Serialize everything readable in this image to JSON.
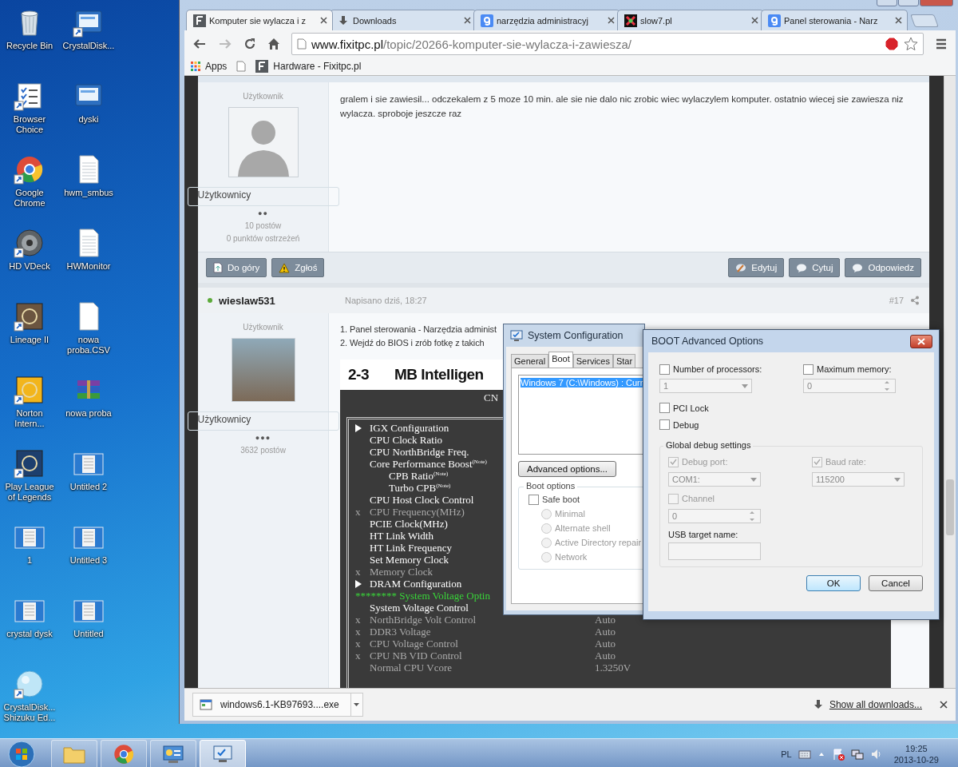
{
  "desktop": {
    "icons": [
      {
        "label": "Recycle Bin",
        "kind": "bin",
        "shortcut": false
      },
      {
        "label": "CrystalDisk...",
        "kind": "monitor",
        "shortcut": true
      },
      {
        "label": "Browser Choice",
        "kind": "checklist",
        "shortcut": true
      },
      {
        "label": "dyski",
        "kind": "monitor",
        "shortcut": false
      },
      {
        "label": "Google Chrome",
        "kind": "chrome",
        "shortcut": true
      },
      {
        "label": "hwm_smbus",
        "kind": "document",
        "shortcut": false
      },
      {
        "label": "HD VDeck",
        "kind": "disc",
        "shortcut": true
      },
      {
        "label": "HWMonitor",
        "kind": "document",
        "shortcut": false
      },
      {
        "label": "Lineage II",
        "kind": "tile",
        "color": "#6b5540",
        "shortcut": true
      },
      {
        "label": "nowa proba.CSV",
        "kind": "blank",
        "shortcut": false
      },
      {
        "label": "Norton Intern...",
        "kind": "tile",
        "color": "#f2b51c",
        "shortcut": true
      },
      {
        "label": "nowa proba",
        "kind": "archive",
        "shortcut": false
      },
      {
        "label": "Play League of Legends",
        "kind": "tile",
        "color": "#1d3f6e",
        "shortcut": true
      },
      {
        "label": "Untitled 2",
        "kind": "thumbnail",
        "shortcut": false
      },
      {
        "label": "1",
        "kind": "thumbnail",
        "shortcut": false
      },
      {
        "label": "Untitled 3",
        "kind": "thumbnail",
        "shortcut": false
      },
      {
        "label": "crystal dysk",
        "kind": "thumbnail",
        "shortcut": false
      },
      {
        "label": "Untitled",
        "kind": "thumbnail",
        "shortcut": false
      },
      {
        "label": "CrystalDisk... Shizuku Ed...",
        "kind": "sphere",
        "shortcut": true
      }
    ]
  },
  "browser": {
    "tabs": [
      {
        "title": "Komputer sie wylacza i z",
        "kind": "site",
        "selected": true
      },
      {
        "title": "Downloads",
        "kind": "download",
        "selected": false
      },
      {
        "title": "narzędzia administracyj",
        "kind": "search",
        "selected": false
      },
      {
        "title": "slow7.pl",
        "kind": "mosaic",
        "selected": false
      },
      {
        "title": "Panel sterowania - Narz",
        "kind": "search",
        "selected": false
      }
    ],
    "address": {
      "host": "www.fixitpc.pl",
      "path": "/topic/20266-komputer-sie-wylacza-i-zawiesza/"
    },
    "bookmarks": [
      {
        "kind": "apps",
        "label": "Apps"
      },
      {
        "kind": "page"
      },
      {
        "kind": "site",
        "label": "Hardware - Fixitpc.pl"
      }
    ],
    "posts": [
      {
        "rank": "Użytkownik",
        "avatar": {
          "kind": "silhouette"
        },
        "group": "Użytkownicy",
        "pips": "●●",
        "stats": [
          "10 postów",
          "0 punktów ostrzeżeń"
        ],
        "body": [
          "gralem i sie zawiesil... odczekalem z 5 moze 10 min. ale sie nie dalo nic zrobic wiec wylaczylem komputer. ostatnio wiecej sie zawiesza niz wylacza. sproboje jeszcze raz"
        ],
        "actions_left": [
          {
            "label": "Do góry",
            "kind": "page"
          },
          {
            "label": "Zgłoś",
            "kind": "warning"
          }
        ],
        "actions_right": [
          {
            "label": "Edytuj",
            "kind": "pencil"
          },
          {
            "label": "Cytuj",
            "kind": "bubble"
          },
          {
            "label": "Odpowiedz",
            "kind": "bubble"
          }
        ]
      },
      {
        "author": "wieslaw531",
        "online": true,
        "posted": "Napisano dziś, 18:27",
        "number": "#17",
        "rank": "Użytkownik",
        "avatar": {
          "kind": "photo"
        },
        "group": "Użytkownicy",
        "pips": "●●●",
        "stats": [
          "3632 postów"
        ],
        "body": [
          "1. Panel sterowania - Narzędzia administ",
          "2. Wejdź do BIOS i zrób fotkę z takich"
        ],
        "image": {
          "section": "2-3",
          "title": "MB Intelligen",
          "header": "CN",
          "rows": [
            {
              "kind": "submenu",
              "label": "IGX Configuration",
              "dim": false
            },
            {
              "kind": "item",
              "label": "CPU Clock Ratio",
              "dim": false
            },
            {
              "kind": "item",
              "label": "CPU NorthBridge Freq.",
              "dim": false
            },
            {
              "kind": "item",
              "label": "Core Performance Boost$^{(Note)}$",
              "dim": false,
              "children": [
                {
                  "label": "CPB Ratio$^{(Note)}$",
                  "dim": false
                },
                {
                  "label": "Turbo CPB$^{(Note)}$",
                  "dim": false
                }
              ]
            },
            {
              "kind": "item",
              "label": "CPU Host Clock Control",
              "dim": false
            },
            {
              "kind": "item",
              "prefix": "x",
              "label": "CPU Frequency(MHz)",
              "dim": true
            },
            {
              "kind": "item",
              "label": "PCIE Clock(MHz)",
              "dim": false
            },
            {
              "kind": "item",
              "label": "HT Link Width",
              "dim": false
            },
            {
              "kind": "item",
              "label": "HT Link Frequency",
              "dim": false
            },
            {
              "kind": "item",
              "label": "Set Memory Clock",
              "dim": false
            },
            {
              "kind": "item",
              "prefix": "x",
              "label": "Memory Clock",
              "dim": true
            },
            {
              "kind": "submenu",
              "label": "DRAM Configuration",
              "dim": false
            },
            {
              "kind": "heading",
              "label": "******** System Voltage Optin",
              "dim": false
            },
            {
              "kind": "item",
              "label": "System Voltage Control",
              "dim": false
            },
            {
              "kind": "item",
              "prefix": "x",
              "label": "NorthBridge Volt Control",
              "value": "Auto",
              "dim": true
            },
            {
              "kind": "item",
              "prefix": "x",
              "label": "DDR3 Voltage",
              "value": "Auto",
              "dim": true
            },
            {
              "kind": "item",
              "prefix": "x",
              "label": "CPU Voltage Control",
              "value": "Auto",
              "dim": true
            },
            {
              "kind": "item",
              "prefix": "x",
              "label": "CPU NB VID Control",
              "value": "Auto",
              "dim": true
            },
            {
              "kind": "item",
              "label": "Normal CPU Vcore",
              "value": "1.3250V",
              "dim": true
            }
          ]
        }
      }
    ],
    "download": {
      "file": "windows6.1-KB97693....exe",
      "show_all": "Show all downloads..."
    }
  },
  "system_config": {
    "title": "System Configuration",
    "tabs": [
      {
        "label": "General",
        "selected": false
      },
      {
        "label": "Boot",
        "selected": true
      },
      {
        "label": "Services",
        "selected": false
      },
      {
        "label": "Star",
        "selected": false
      }
    ],
    "entries": [
      {
        "label": "Windows 7 (C:\\Windows) : Curr",
        "selected": true
      }
    ],
    "advanced_button": "Advanced options...",
    "boot_options": {
      "title": "Boot options",
      "safe_boot": {
        "label": "Safe boot",
        "checked": false
      },
      "modes": [
        {
          "label": "Minimal",
          "selected": false,
          "disabled": true
        },
        {
          "label": "Alternate shell",
          "selected": false,
          "disabled": true
        },
        {
          "label": "Active Directory repair",
          "selected": false,
          "disabled": true
        },
        {
          "label": "Network",
          "selected": false,
          "disabled": true
        }
      ]
    }
  },
  "boot_advanced": {
    "title": "BOOT Advanced Options",
    "top": [
      {
        "check": {
          "label": "Number of processors:",
          "checked": false,
          "disabled": false
        },
        "control": {
          "kind": "dropdown",
          "value": "1",
          "disabled": true
        }
      },
      {
        "check": {
          "label": "Maximum memory:",
          "checked": false,
          "disabled": false
        },
        "control": {
          "kind": "spinner",
          "value": "0",
          "disabled": true
        }
      }
    ],
    "flags": [
      {
        "label": "PCI Lock",
        "checked": false,
        "disabled": false
      },
      {
        "label": "Debug",
        "checked": false,
        "disabled": false
      }
    ],
    "debug_group": {
      "title": "Global debug settings",
      "settings": [
        {
          "check": {
            "label": "Debug port:",
            "checked": true,
            "disabled": true
          },
          "control": {
            "kind": "dropdown",
            "value": "COM1:",
            "disabled": true
          }
        },
        {
          "check": {
            "label": "Baud rate:",
            "checked": true,
            "disabled": true
          },
          "control": {
            "kind": "dropdown",
            "value": "115200",
            "disabled": true
          }
        },
        {
          "check": {
            "label": "Channel",
            "checked": false,
            "disabled": true
          },
          "control": {
            "kind": "spinner",
            "value": "0",
            "disabled": true
          }
        }
      ],
      "usb_label": "USB target name:"
    },
    "buttons": [
      {
        "label": "OK",
        "default": true
      },
      {
        "label": "Cancel",
        "default": false
      }
    ]
  },
  "taskbar": {
    "items": [
      {
        "kind": "folder",
        "selected": false
      },
      {
        "kind": "chrome",
        "selected": false
      },
      {
        "kind": "panel",
        "selected": false
      },
      {
        "kind": "config",
        "selected": true
      }
    ],
    "language": "PL",
    "time": "19:25",
    "date": "2013-10-29"
  }
}
